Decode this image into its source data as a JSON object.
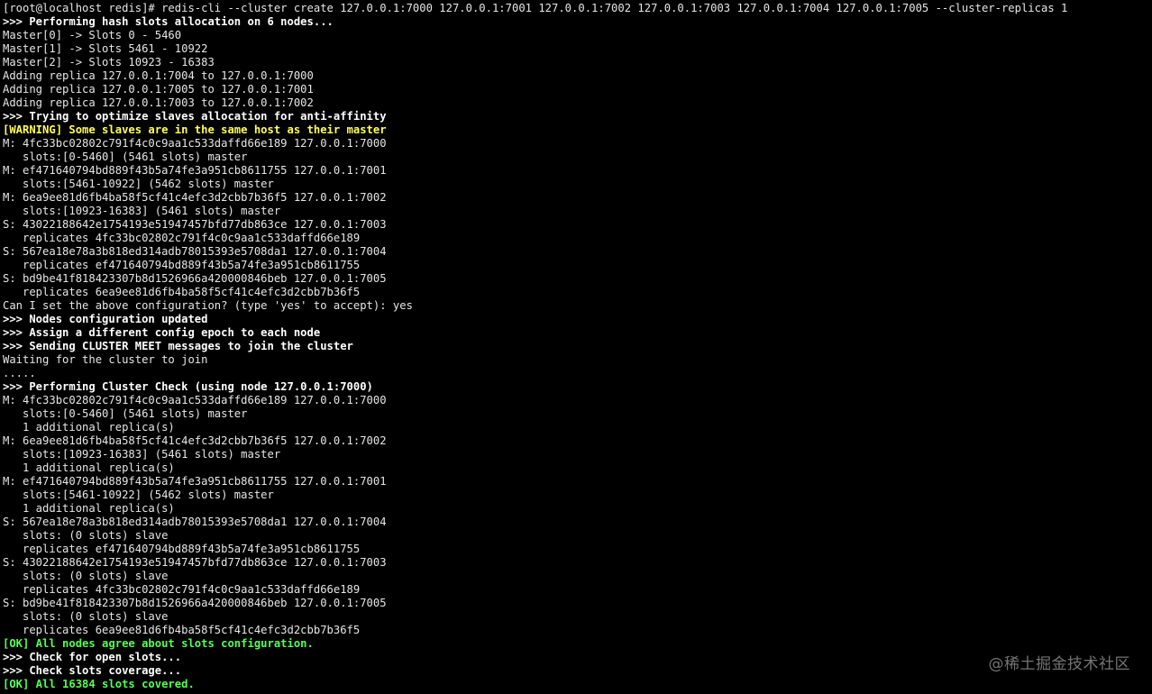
{
  "terminal": {
    "lines": [
      {
        "text": "[root@localhost redis]# redis-cli --cluster create 127.0.0.1:7000 127.0.0.1:7001 127.0.0.1:7002 127.0.0.1:7003 127.0.0.1:7004 127.0.0.1:7005 --cluster-replicas 1",
        "style": "normal"
      },
      {
        "text": ">>> Performing hash slots allocation on 6 nodes...",
        "style": "bold"
      },
      {
        "text": "Master[0] -> Slots 0 - 5460",
        "style": "normal"
      },
      {
        "text": "Master[1] -> Slots 5461 - 10922",
        "style": "normal"
      },
      {
        "text": "Master[2] -> Slots 10923 - 16383",
        "style": "normal"
      },
      {
        "text": "Adding replica 127.0.0.1:7004 to 127.0.0.1:7000",
        "style": "normal"
      },
      {
        "text": "Adding replica 127.0.0.1:7005 to 127.0.0.1:7001",
        "style": "normal"
      },
      {
        "text": "Adding replica 127.0.0.1:7003 to 127.0.0.1:7002",
        "style": "normal"
      },
      {
        "text": ">>> Trying to optimize slaves allocation for anti-affinity",
        "style": "bold"
      },
      {
        "text": "[WARNING] Some slaves are in the same host as their master",
        "style": "warn"
      },
      {
        "text": "M: 4fc33bc02802c791f4c0c9aa1c533daffd66e189 127.0.0.1:7000",
        "style": "normal"
      },
      {
        "text": "   slots:[0-5460] (5461 slots) master",
        "style": "normal"
      },
      {
        "text": "M: ef471640794bd889f43b5a74fe3a951cb8611755 127.0.0.1:7001",
        "style": "normal"
      },
      {
        "text": "   slots:[5461-10922] (5462 slots) master",
        "style": "normal"
      },
      {
        "text": "M: 6ea9ee81d6fb4ba58f5cf41c4efc3d2cbb7b36f5 127.0.0.1:7002",
        "style": "normal"
      },
      {
        "text": "   slots:[10923-16383] (5461 slots) master",
        "style": "normal"
      },
      {
        "text": "S: 43022188642e1754193e51947457bfd77db863ce 127.0.0.1:7003",
        "style": "normal"
      },
      {
        "text": "   replicates 4fc33bc02802c791f4c0c9aa1c533daffd66e189",
        "style": "normal"
      },
      {
        "text": "S: 567ea18e78a3b818ed314adb78015393e5708da1 127.0.0.1:7004",
        "style": "normal"
      },
      {
        "text": "   replicates ef471640794bd889f43b5a74fe3a951cb8611755",
        "style": "normal"
      },
      {
        "text": "S: bd9be41f818423307b8d1526966a420000846beb 127.0.0.1:7005",
        "style": "normal"
      },
      {
        "text": "   replicates 6ea9ee81d6fb4ba58f5cf41c4efc3d2cbb7b36f5",
        "style": "normal"
      },
      {
        "text": "Can I set the above configuration? (type 'yes' to accept): yes",
        "style": "normal"
      },
      {
        "text": ">>> Nodes configuration updated",
        "style": "bold"
      },
      {
        "text": ">>> Assign a different config epoch to each node",
        "style": "bold"
      },
      {
        "text": ">>> Sending CLUSTER MEET messages to join the cluster",
        "style": "bold"
      },
      {
        "text": "Waiting for the cluster to join",
        "style": "normal"
      },
      {
        "text": ".....",
        "style": "normal"
      },
      {
        "text": ">>> Performing Cluster Check (using node 127.0.0.1:7000)",
        "style": "bold"
      },
      {
        "text": "M: 4fc33bc02802c791f4c0c9aa1c533daffd66e189 127.0.0.1:7000",
        "style": "normal"
      },
      {
        "text": "   slots:[0-5460] (5461 slots) master",
        "style": "normal"
      },
      {
        "text": "   1 additional replica(s)",
        "style": "normal"
      },
      {
        "text": "M: 6ea9ee81d6fb4ba58f5cf41c4efc3d2cbb7b36f5 127.0.0.1:7002",
        "style": "normal"
      },
      {
        "text": "   slots:[10923-16383] (5461 slots) master",
        "style": "normal"
      },
      {
        "text": "   1 additional replica(s)",
        "style": "normal"
      },
      {
        "text": "M: ef471640794bd889f43b5a74fe3a951cb8611755 127.0.0.1:7001",
        "style": "normal"
      },
      {
        "text": "   slots:[5461-10922] (5462 slots) master",
        "style": "normal"
      },
      {
        "text": "   1 additional replica(s)",
        "style": "normal"
      },
      {
        "text": "S: 567ea18e78a3b818ed314adb78015393e5708da1 127.0.0.1:7004",
        "style": "normal"
      },
      {
        "text": "   slots: (0 slots) slave",
        "style": "normal"
      },
      {
        "text": "   replicates ef471640794bd889f43b5a74fe3a951cb8611755",
        "style": "normal"
      },
      {
        "text": "S: 43022188642e1754193e51947457bfd77db863ce 127.0.0.1:7003",
        "style": "normal"
      },
      {
        "text": "   slots: (0 slots) slave",
        "style": "normal"
      },
      {
        "text": "   replicates 4fc33bc02802c791f4c0c9aa1c533daffd66e189",
        "style": "normal"
      },
      {
        "text": "S: bd9be41f818423307b8d1526966a420000846beb 127.0.0.1:7005",
        "style": "normal"
      },
      {
        "text": "   slots: (0 slots) slave",
        "style": "normal"
      },
      {
        "text": "   replicates 6ea9ee81d6fb4ba58f5cf41c4efc3d2cbb7b36f5",
        "style": "normal"
      },
      {
        "text": "[OK] All nodes agree about slots configuration.",
        "style": "ok"
      },
      {
        "text": ">>> Check for open slots...",
        "style": "bold"
      },
      {
        "text": ">>> Check slots coverage...",
        "style": "bold"
      },
      {
        "text": "[OK] All 16384 slots covered.",
        "style": "ok"
      }
    ]
  },
  "watermark": {
    "text": "@稀土掘金技术社区"
  },
  "colors": {
    "background": "#000000",
    "text": "#e6e6e6",
    "bold": "#ffffff",
    "warning": "#ffff54",
    "ok": "#54ff54"
  }
}
